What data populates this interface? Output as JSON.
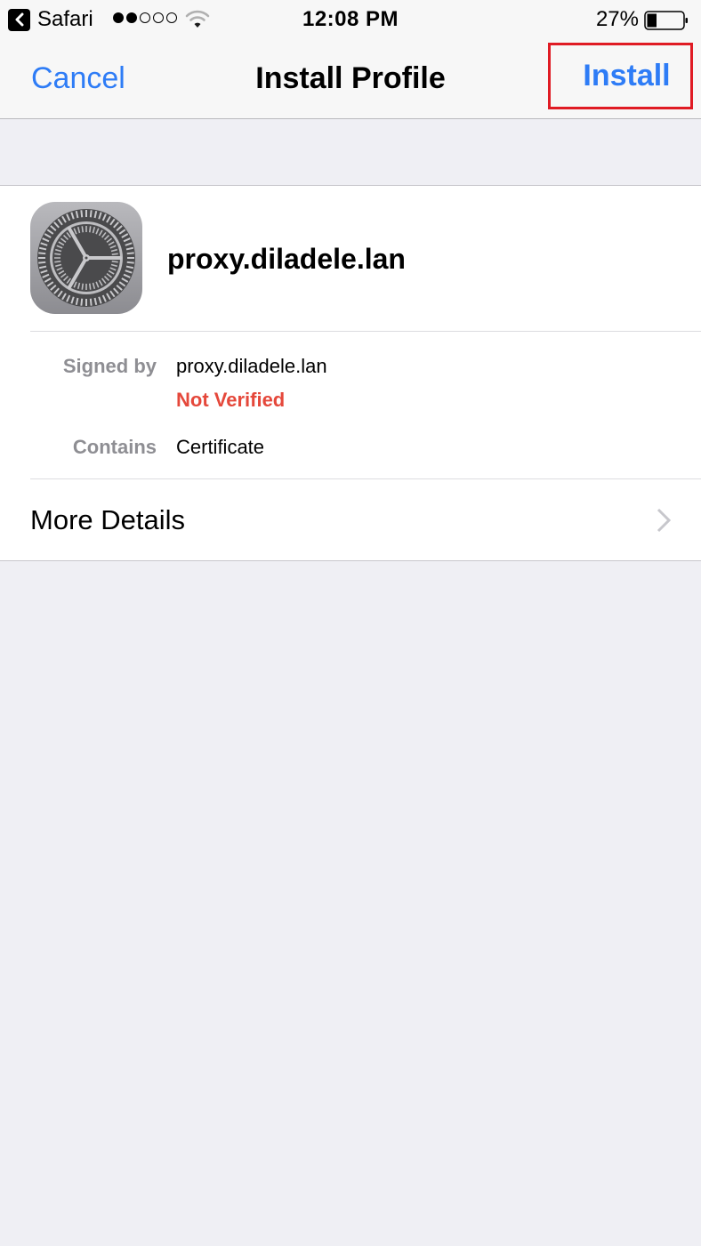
{
  "status_bar": {
    "back_app_label": "Safari",
    "back_icon": "chevron-left-icon",
    "signal_bars_filled": 2,
    "signal_bars_total": 5,
    "wifi_icon": "wifi-icon",
    "time": "12:08 PM",
    "battery_percent_label": "27%",
    "battery_level": 0.27
  },
  "nav_bar": {
    "cancel_label": "Cancel",
    "title": "Install Profile",
    "install_label": "Install",
    "install_highlight_color": "#e01b24"
  },
  "profile": {
    "icon": "settings-gear-icon",
    "name": "proxy.diladele.lan",
    "details": [
      {
        "label": "Signed by",
        "value": "proxy.diladele.lan",
        "status": "Not Verified"
      },
      {
        "label": "Contains",
        "value": "Certificate"
      }
    ],
    "more_details_label": "More Details"
  },
  "colors": {
    "accent": "#2e7cf6",
    "warning": "#e5483b",
    "background": "#efeff4",
    "nav_background": "#f7f7f7"
  }
}
